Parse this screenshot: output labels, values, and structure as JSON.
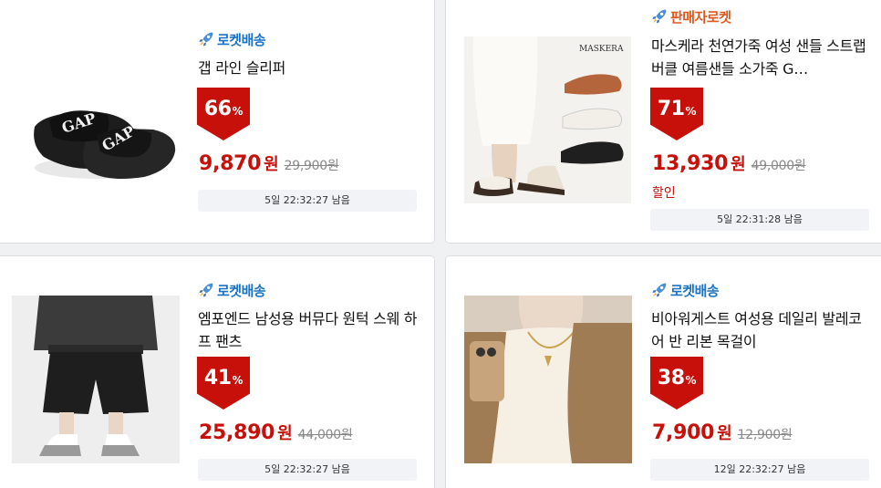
{
  "colors": {
    "rocket": "#1a73c4",
    "seller": "#e0581d",
    "sale": "#c8100b",
    "timer_bg": "#f1f3f6"
  },
  "products": [
    {
      "image_icon": "slipper-image",
      "badge_icon": "rocket-icon",
      "badge_label": "로켓배송",
      "title": "갭 라인 슬리퍼",
      "discount": "66",
      "discount_unit": "%",
      "sale_price": "9,870",
      "currency": "원",
      "original_price": "29,900원",
      "timer": "5일 22:32:27 남음"
    },
    {
      "image_icon": "sandal-image",
      "badge_icon": "rocket-icon",
      "badge_label": "판매자로켓",
      "title": "마스케라 천연가죽 여성 샌들 스트랩 버클 여름샌들 소가죽 G…",
      "discount": "71",
      "discount_unit": "%",
      "sale_price": "13,930",
      "currency": "원",
      "original_price": "49,000원",
      "note": "할인",
      "timer": "5일 22:31:28 남음"
    },
    {
      "image_icon": "shorts-image",
      "badge_icon": "rocket-icon",
      "badge_label": "로켓배송",
      "title": "엠포엔드 남성용 버뮤다 원턱 스웨 하프 팬츠",
      "discount": "41",
      "discount_unit": "%",
      "sale_price": "25,890",
      "currency": "원",
      "original_price": "44,000원",
      "timer": "5일 22:32:27 남음"
    },
    {
      "image_icon": "necklace-image",
      "badge_icon": "rocket-icon",
      "badge_label": "로켓배송",
      "title": "비아워게스트 여성용 데일리 발레코어 반 리본 목걸이",
      "discount": "38",
      "discount_unit": "%",
      "sale_price": "7,900",
      "currency": "원",
      "original_price": "12,900원",
      "timer": "12일 22:32:27 남음"
    }
  ]
}
